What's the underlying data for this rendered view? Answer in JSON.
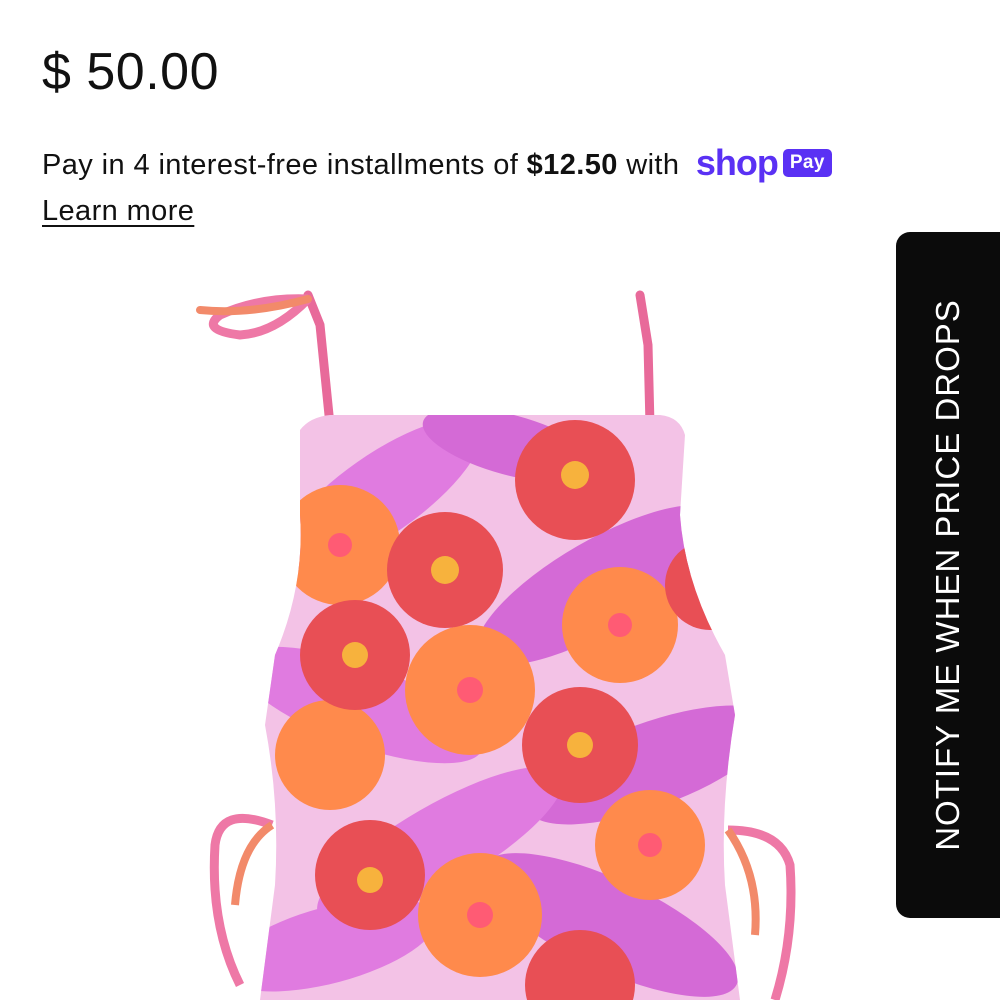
{
  "product": {
    "price": "$ 50.00",
    "image_alt": "floral one-piece swimsuit"
  },
  "installments": {
    "prefix": "Pay in 4 interest-free installments of ",
    "amount": "$12.50",
    "suffix": " with ",
    "provider_word": "shop",
    "provider_badge": "Pay",
    "learn_more": "Learn more"
  },
  "notify": {
    "label": "NOTIFY ME WHEN PRICE DROPS"
  },
  "colors": {
    "shop_purple": "#5a31f4",
    "tab_black": "#0b0b0b"
  }
}
